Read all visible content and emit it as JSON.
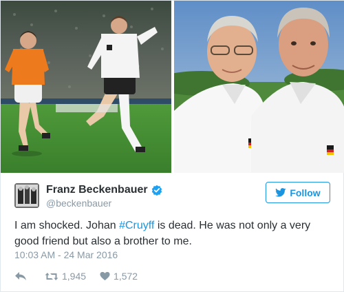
{
  "tweet": {
    "author": {
      "name": "Franz Beckenbauer",
      "handle": "@beckenbauer",
      "verified": true
    },
    "follow_label": "Follow",
    "text_before": "I am shocked. Johan ",
    "hashtag": "#Cruyff",
    "text_after": " is dead. He was not only a very good friend but also a brother to me.",
    "timestamp": "10:03 AM - 24 Mar 2016",
    "retweets": "1,945",
    "likes": "1,572"
  },
  "colors": {
    "accent": "#1b95e0",
    "muted": "#8899a6",
    "text": "#292f33"
  },
  "icons": {
    "verified": "verified-badge-icon",
    "follow": "twitter-bird-icon",
    "reply": "reply-icon",
    "retweet": "retweet-icon",
    "like": "heart-icon"
  }
}
